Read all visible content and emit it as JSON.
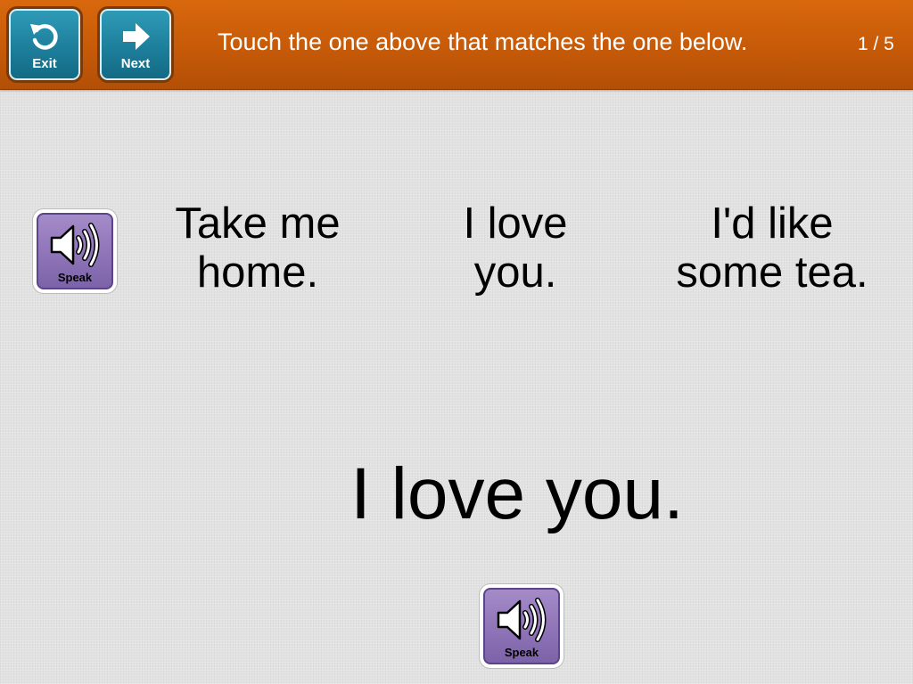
{
  "header": {
    "exit_label": "Exit",
    "next_label": "Next",
    "instruction": "Touch the one above that matches the one below.",
    "progress": "1 / 5"
  },
  "choices": [
    {
      "line1": "Take me",
      "line2": "home."
    },
    {
      "line1": "I love",
      "line2": "you."
    },
    {
      "line1": "I'd like",
      "line2": "some tea."
    }
  ],
  "target": {
    "text": "I love you."
  },
  "speak": {
    "label": "Speak"
  },
  "icons": {
    "exit": "undo-arrow-icon",
    "next": "right-arrow-icon",
    "speak": "speaker-icon"
  },
  "colors": {
    "header": "#c65a08",
    "nav_button": "#1d7f9c",
    "speak_button": "#8f74b8",
    "background": "#e2e2e2"
  }
}
